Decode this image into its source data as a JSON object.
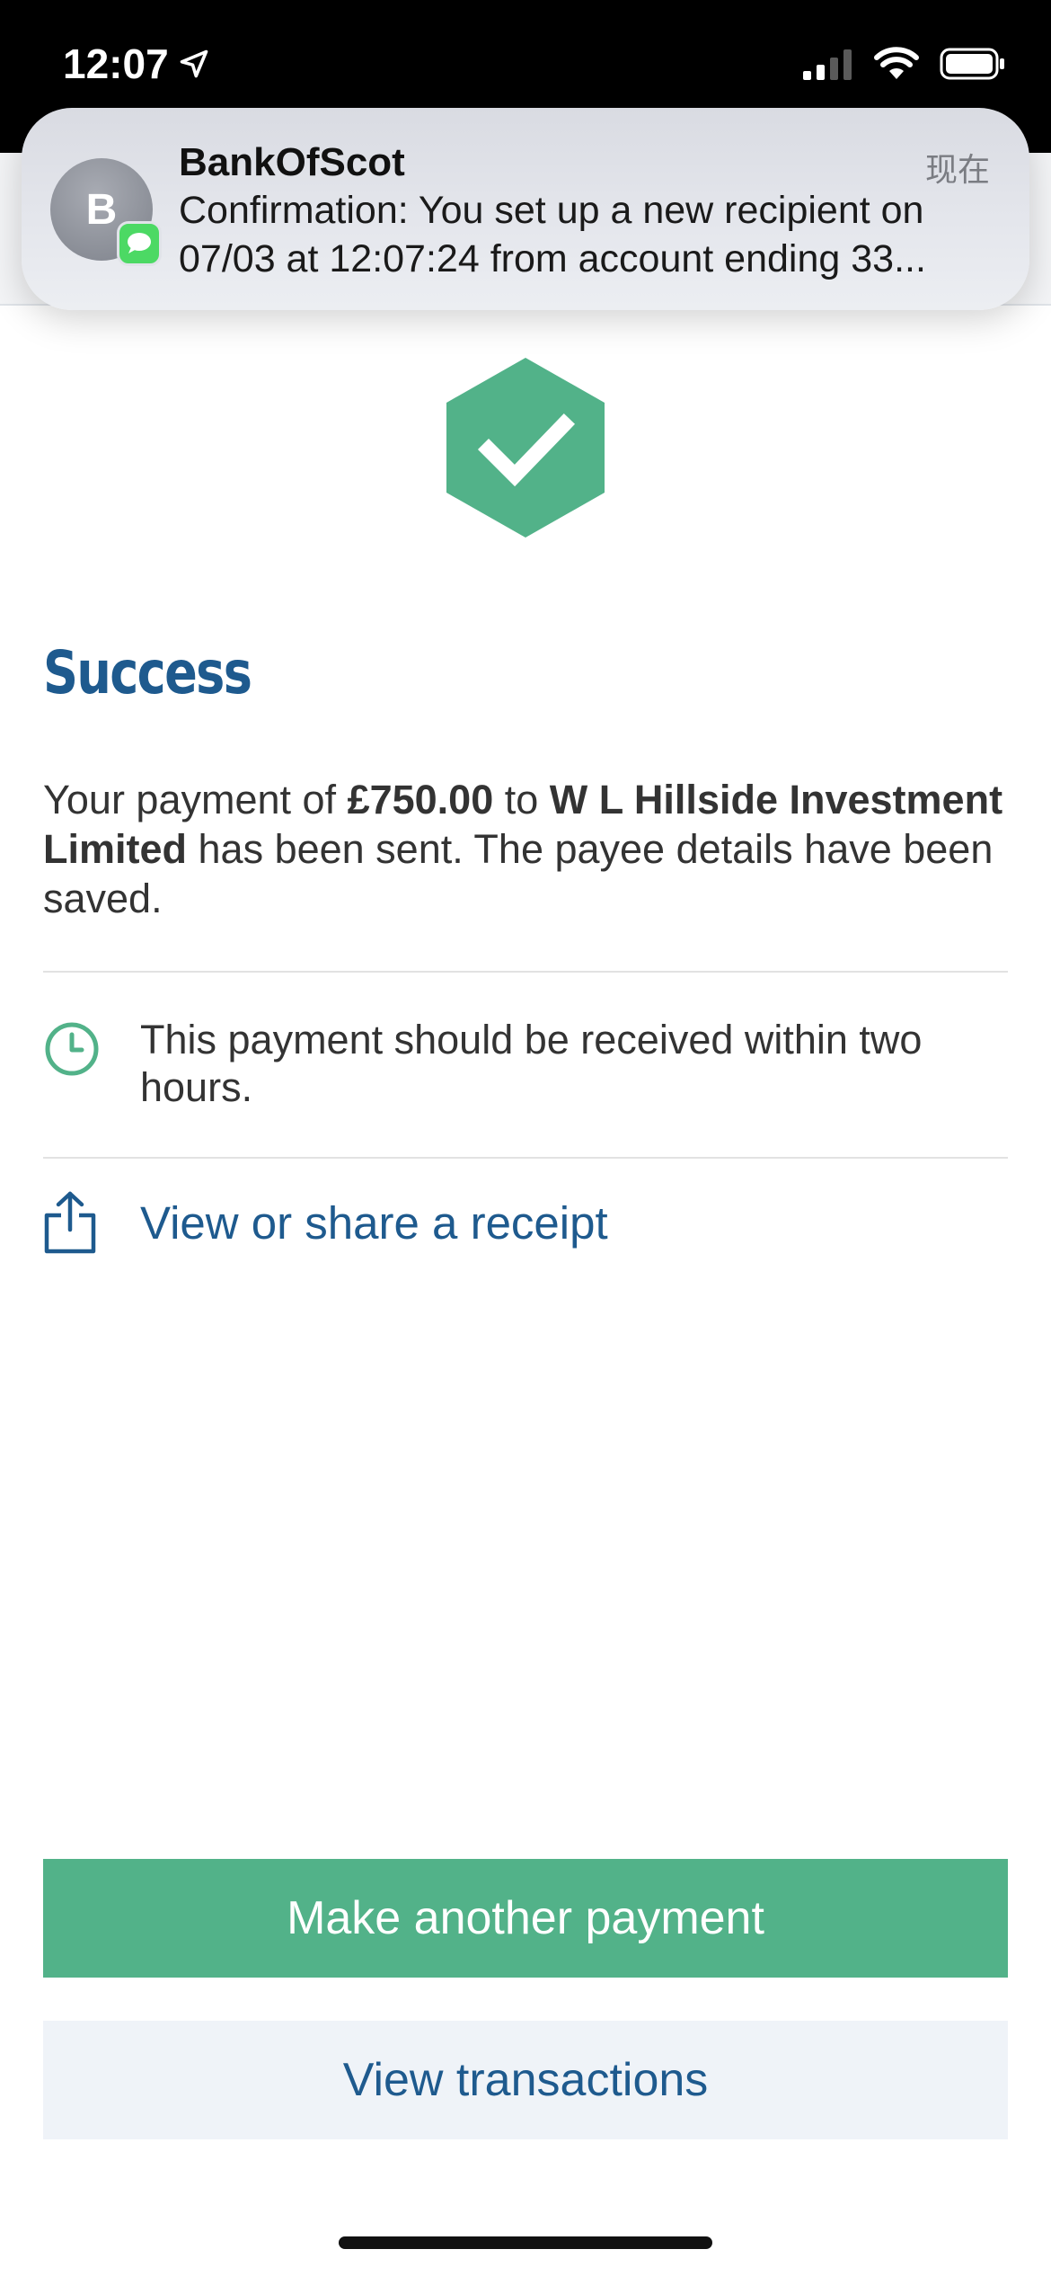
{
  "status_bar": {
    "time": "12:07",
    "icons": [
      "location-arrow-icon",
      "cellular-signal-icon",
      "wifi-icon",
      "battery-icon"
    ]
  },
  "notification": {
    "avatar_initial": "B",
    "app_badge_icon": "messages-icon",
    "sender": "BankOfScot",
    "time": "现在",
    "body_line1": "Confirmation: You set up a new recipient on",
    "body_line2": "07/03 at 12:07:24 from account ending 33..."
  },
  "result": {
    "icon": "hexagon-checkmark-icon",
    "heading": "Success",
    "message_prefix": "Your payment of ",
    "amount": "£750.00",
    "message_to": " to ",
    "payee": "W L Hillside Investment Limited",
    "message_suffix": " has been sent. The payee details have been saved."
  },
  "delivery_info": {
    "icon": "clock-icon",
    "text": "This payment should be received within two hours."
  },
  "receipt": {
    "icon": "share-icon",
    "label": "View or share a receipt"
  },
  "actions": {
    "primary_label": "Make another payment",
    "secondary_label": "View transactions"
  },
  "colors": {
    "brand_blue": "#1e5a8e",
    "success_green": "#52b289",
    "secondary_bg": "#eff3f8"
  }
}
